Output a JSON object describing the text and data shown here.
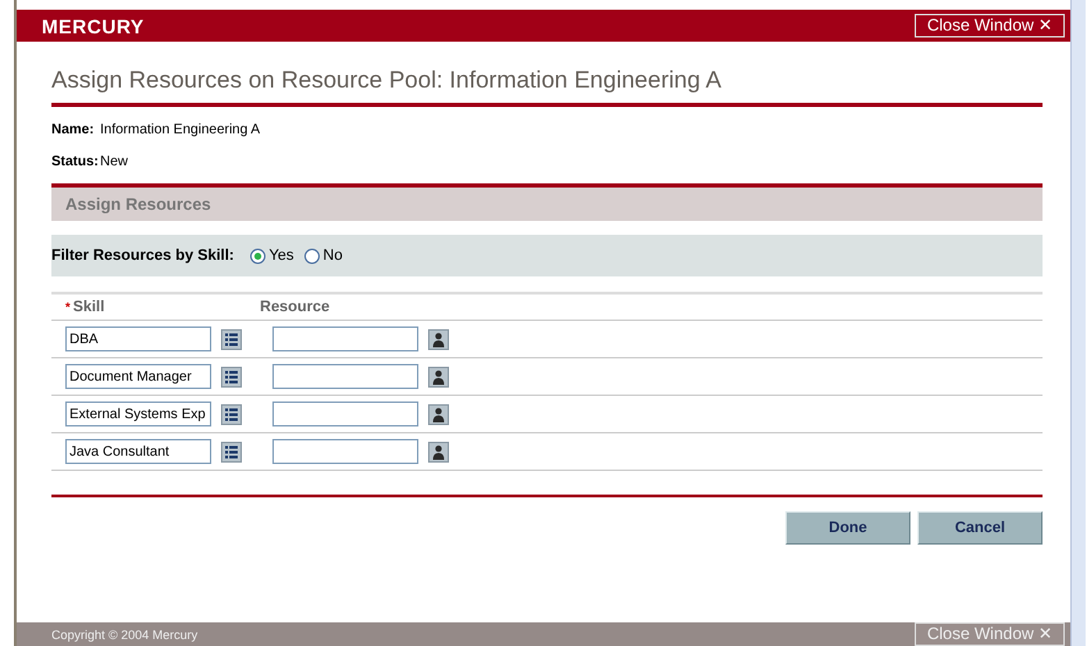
{
  "header": {
    "logo": "MERCURY",
    "close_button": "Close Window ✕"
  },
  "title": "Assign Resources on Resource Pool: Information Engineering A",
  "details": [
    {
      "label": "Name:",
      "value": "Information Engineering A"
    },
    {
      "label": "Status:",
      "value": "New"
    }
  ],
  "section": {
    "title": "Assign Resources"
  },
  "filter": {
    "label": "Filter Resources by Skill:",
    "options": [
      {
        "label": "Yes",
        "selected": true
      },
      {
        "label": "No",
        "selected": false
      }
    ]
  },
  "table": {
    "required_mark": "*",
    "columns": [
      "Skill",
      "Resource"
    ],
    "rows": [
      {
        "skill": "DBA",
        "resource": ""
      },
      {
        "skill": "Document Manager",
        "resource": ""
      },
      {
        "skill": "External Systems Exp",
        "resource": ""
      },
      {
        "skill": "Java Consultant",
        "resource": ""
      }
    ]
  },
  "buttons": [
    "Done",
    "Cancel"
  ],
  "footer": {
    "copyright": "Copyright © 2004 Mercury",
    "close_button": "Close Window ✕"
  }
}
